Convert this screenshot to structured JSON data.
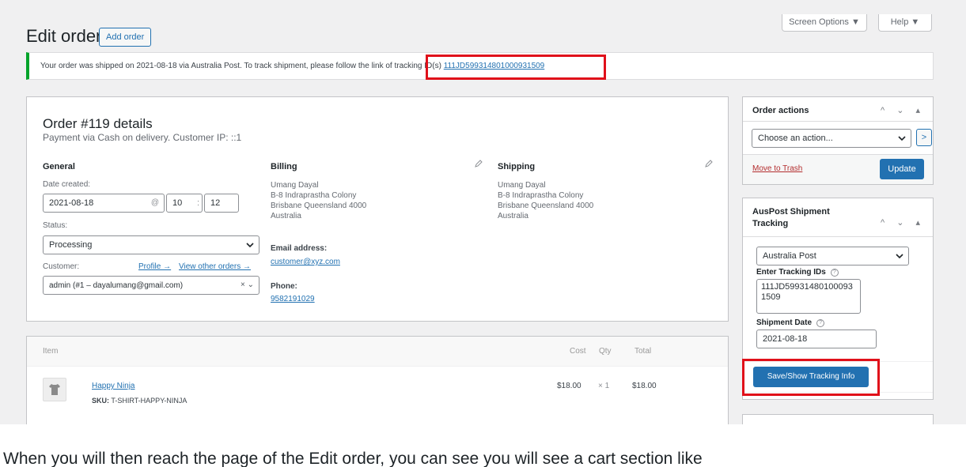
{
  "header": {
    "screen_options": "Screen Options ▼",
    "help": "Help ▼",
    "page_title": "Edit order",
    "add_order": "Add order"
  },
  "notice": {
    "text": "Your order was shipped on 2021-08-18 via Australia Post. To track shipment, please follow the link of tracking ID(s) ",
    "tracking_link": "111JD599314801000931509"
  },
  "order": {
    "title": "Order #119 details",
    "subtitle": "Payment via Cash on delivery. Customer IP: ::1",
    "general": {
      "heading": "General",
      "date_created_label": "Date created:",
      "date": "2021-08-18",
      "at": "@",
      "hour": "10",
      "colon": ":",
      "minute": "12",
      "status_label": "Status:",
      "status": "Processing",
      "customer_label": "Customer:",
      "profile_link": "Profile →",
      "other_orders_link": "View other orders →",
      "customer": "admin (#1 – dayalumang@gmail.com)",
      "customer_controls": "× ⌄"
    },
    "billing": {
      "heading": "Billing",
      "address": [
        "Umang Dayal",
        "B-8 Indraprastha Colony",
        "Brisbane Queensland 4000",
        "Australia"
      ],
      "email_label": "Email address:",
      "email": "customer@xyz.com",
      "phone_label": "Phone:",
      "phone": "9582191029"
    },
    "shipping": {
      "heading": "Shipping",
      "address": [
        "Umang Dayal",
        "B-8 Indraprastha Colony",
        "Brisbane Queensland 4000",
        "Australia"
      ]
    }
  },
  "items": {
    "headers": {
      "item": "Item",
      "cost": "Cost",
      "qty": "Qty",
      "total": "Total"
    },
    "rows": [
      {
        "name": "Happy Ninja",
        "sku_label": "SKU:",
        "sku": "T-SHIRT-HAPPY-NINJA",
        "cost": "$18.00",
        "qty": "× 1",
        "total": "$18.00"
      }
    ]
  },
  "order_actions": {
    "title": "Order actions",
    "select_placeholder": "Choose an action...",
    "go": ">",
    "trash": "Move to Trash",
    "update": "Update"
  },
  "auspost": {
    "title_line1": "AusPost Shipment",
    "title_line2": "Tracking",
    "carrier": "Australia Post",
    "tracking_ids_label": "Enter Tracking IDs",
    "tracking_ids_value": "111JD599314801000931509",
    "shipment_date_label": "Shipment Date",
    "shipment_date": "2021-08-18",
    "save_button": "Save/Show Tracking Info"
  },
  "box_arrows": "^ ⌄ ▴",
  "help_glyph": "?",
  "caption": "When you will then reach the page of the Edit order, you can see you will see a cart section like"
}
